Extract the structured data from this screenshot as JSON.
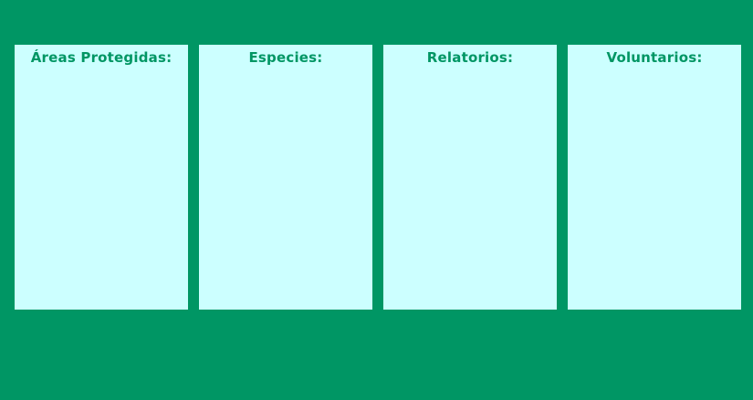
{
  "panels": [
    {
      "title": "Áreas Protegidas:"
    },
    {
      "title": "Especies:"
    },
    {
      "title": "Relatorios:"
    },
    {
      "title": "Voluntarios:"
    }
  ],
  "colors": {
    "background": "#009664",
    "panel": "#ccffff",
    "title": "#009664"
  }
}
